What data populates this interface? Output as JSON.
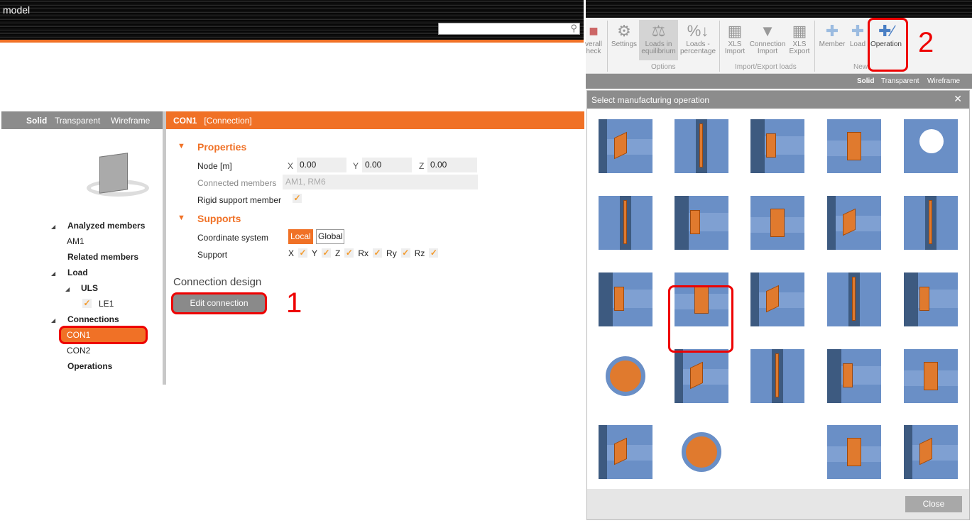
{
  "app": {
    "title": "model",
    "search_placeholder": ""
  },
  "ribbon": {
    "buttons": [
      {
        "label": "verall\nheck",
        "icon": "overall-check-icon"
      },
      {
        "label": "Settings",
        "icon": "gear-icon"
      },
      {
        "label": "Loads in equilibrium",
        "icon": "scales-icon"
      },
      {
        "label": "Loads - percentage",
        "icon": "percentage-icon"
      },
      {
        "label": "XLS Import",
        "icon": "excel-icon"
      },
      {
        "label": "Connection Import",
        "icon": "connection-import-icon"
      },
      {
        "label": "XLS Export",
        "icon": "excel-icon"
      },
      {
        "label": "Member",
        "icon": "member-plus-icon"
      },
      {
        "label": "Load",
        "icon": "load-plus-icon"
      },
      {
        "label": "Operation",
        "icon": "operation-plus-icon"
      }
    ],
    "groups": [
      "Options",
      "Import/Export loads",
      "New"
    ]
  },
  "view_modes": [
    "Solid",
    "Transparent",
    "Wireframe"
  ],
  "dialog": {
    "title": "Select manufacturing operation",
    "close_label": "Close",
    "selected_index": 11,
    "operations": [
      "stiffener",
      "plate-web",
      "end-plate-fin",
      "base-plate",
      "opening",
      "bolted-web-plate",
      "plate-flange",
      "cleat",
      "splice-plate",
      "bolted-plate",
      "angled-member",
      "fin-plate",
      "web-plate-bolts",
      "end-plate-bolts",
      "base-plate-legs",
      "pipe-cut",
      "flange-plate",
      "flange-cut",
      "gusset-bolts",
      "cover-plate",
      "grid-plate",
      "pipe-opening",
      null,
      "truss-gusset",
      "side-plate-bolts"
    ]
  },
  "tree": {
    "analyzed_members": "Analyzed members",
    "am1": "AM1",
    "related_members": "Related members",
    "load": "Load",
    "uls": "ULS",
    "le1": "LE1",
    "connections": "Connections",
    "con1": "CON1",
    "con2": "CON2",
    "operations": "Operations"
  },
  "header": {
    "name": "CON1",
    "type": "[Connection]"
  },
  "properties": {
    "title": "Properties",
    "node_label": "Node [m]",
    "x_label": "X",
    "x": "0.00",
    "y_label": "Y",
    "y": "0.00",
    "z_label": "Z",
    "z": "0.00",
    "connected_label": "Connected members",
    "connected": "AM1, RM6",
    "rigid_label": "Rigid support member"
  },
  "supports": {
    "title": "Supports",
    "coord_label": "Coordinate system",
    "local": "Local",
    "global": "Global",
    "support_label": "Support",
    "axes": [
      "X",
      "Y",
      "Z",
      "Rx",
      "Ry",
      "Rz"
    ]
  },
  "design": {
    "title": "Connection design",
    "edit_label": "Edit connection"
  },
  "annotations": {
    "step1": "1",
    "step2": "2"
  },
  "colors": {
    "accent": "#f07126",
    "highlight": "#e00000"
  }
}
